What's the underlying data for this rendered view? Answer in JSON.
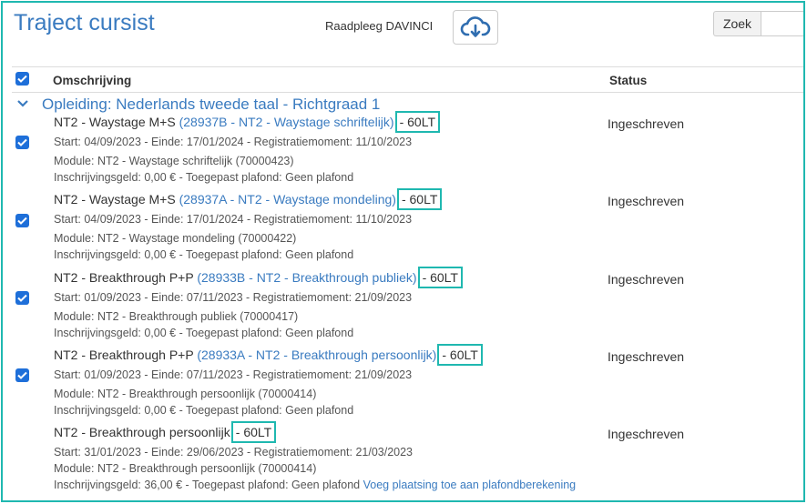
{
  "header": {
    "title": "Traject cursist",
    "davinci_label": "Raadpleeg DAVINCI",
    "search_label": "Zoek",
    "search_placeholder": ""
  },
  "table": {
    "col_omschrijving": "Omschrijving",
    "col_status": "Status"
  },
  "group": {
    "title": "Opleiding: Nederlands tweede taal - Richtgraad 1"
  },
  "courses": [
    {
      "name": "NT2 - Waystage M+S",
      "link": "(28937B - NT2 - Waystage schriftelijk)",
      "badge": "- 60LT",
      "dates": "Start: 04/09/2023 - Einde: 17/01/2024 - Registratiemoment: 11/10/2023",
      "module": "Module: NT2 - Waystage schriftelijk (70000423)",
      "fee": "Inschrijvingsgeld: 0,00 € - Toegepast plafond: Geen plafond",
      "status": "Ingeschreven"
    },
    {
      "name": "NT2 - Waystage M+S",
      "link": "(28937A - NT2 - Waystage mondeling)",
      "badge": "- 60LT",
      "dates": "Start: 04/09/2023 - Einde: 17/01/2024 - Registratiemoment: 11/10/2023",
      "module": "Module: NT2 - Waystage mondeling (70000422)",
      "fee": "Inschrijvingsgeld: 0,00 € - Toegepast plafond: Geen plafond",
      "status": "Ingeschreven"
    },
    {
      "name": "NT2 - Breakthrough P+P",
      "link": "(28933B - NT2 - Breakthrough publiek)",
      "badge": "- 60LT",
      "dates": "Start: 01/09/2023 - Einde: 07/11/2023 - Registratiemoment: 21/09/2023",
      "module": "Module: NT2 - Breakthrough publiek (70000417)",
      "fee": "Inschrijvingsgeld: 0,00 € - Toegepast plafond: Geen plafond",
      "status": "Ingeschreven"
    },
    {
      "name": "NT2 - Breakthrough P+P",
      "link": "(28933A - NT2 - Breakthrough persoonlijk)",
      "badge": "- 60LT",
      "dates": "Start: 01/09/2023 - Einde: 07/11/2023 - Registratiemoment: 21/09/2023",
      "module": "Module: NT2 - Breakthrough persoonlijk (70000414)",
      "fee": "Inschrijvingsgeld: 0,00 € - Toegepast plafond: Geen plafond",
      "status": "Ingeschreven"
    },
    {
      "name": "NT2 - Breakthrough persoonlijk",
      "link": "",
      "badge": "- 60LT",
      "dates": "Start: 31/01/2023 - Einde: 29/06/2023 - Registratiemoment: 21/03/2023",
      "module": "Module: NT2 - Breakthrough persoonlijk (70000414)",
      "fee": "Inschrijvingsgeld: 36,00 € - Toegepast plafond: Geen plafond",
      "fee_link": "Voeg plaatsing toe aan plafondberekening",
      "status": "Ingeschreven"
    }
  ],
  "colors": {
    "accent": "#3a7bc0",
    "highlight": "#1fb8b0",
    "checkbox": "#1e6fd9"
  },
  "icons": {
    "cloud": "cloud-download-icon",
    "checkbox": "checkbox-checked-icon",
    "chevron": "chevron-down-icon"
  }
}
